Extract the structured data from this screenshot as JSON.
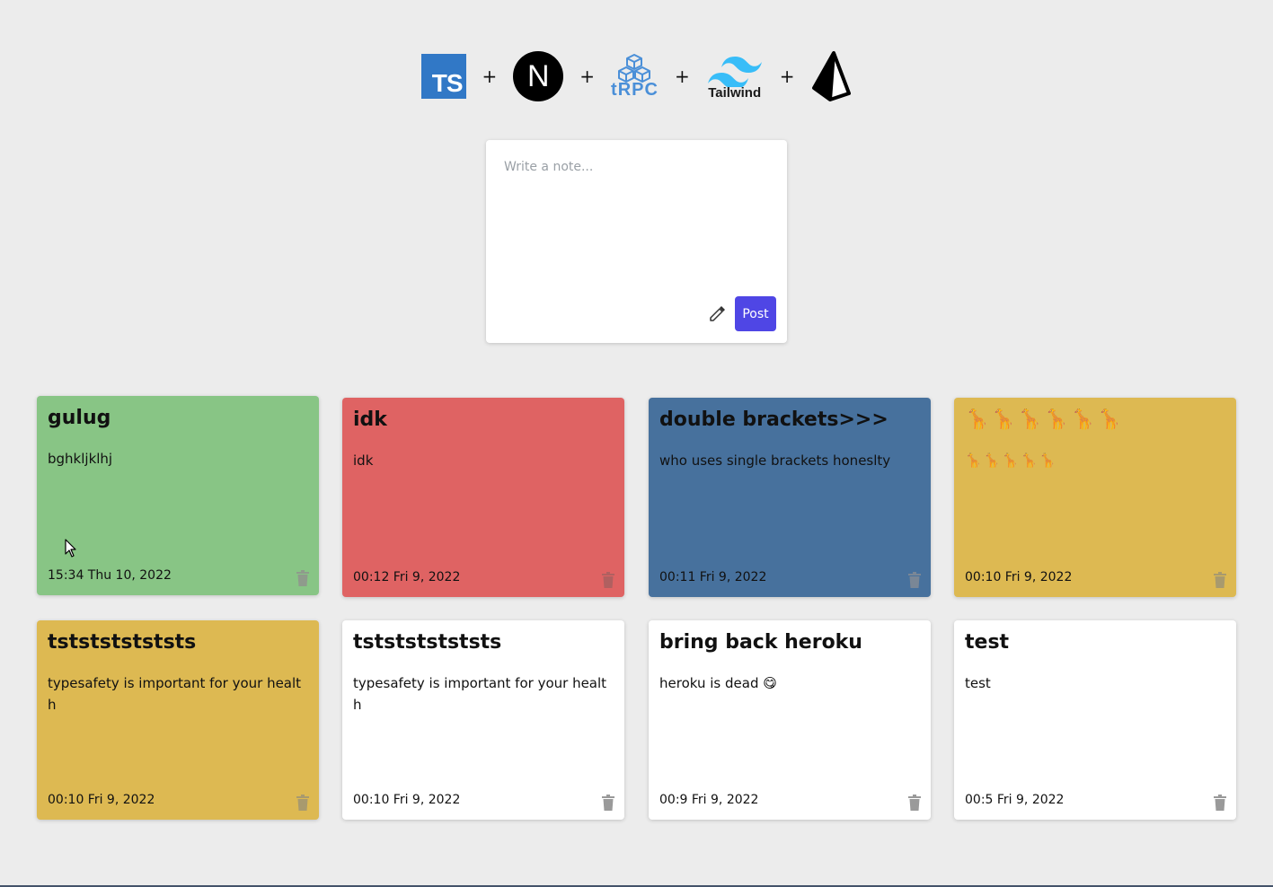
{
  "logos": [
    {
      "name": "typescript",
      "text": "TS"
    },
    {
      "name": "nextjs",
      "text": "N"
    },
    {
      "name": "trpc",
      "text": "tRPC"
    },
    {
      "name": "tailwind",
      "text": "Tailwind"
    },
    {
      "name": "prisma",
      "text": ""
    }
  ],
  "plus": "+",
  "composer": {
    "placeholder": "Write a note...",
    "value": "",
    "post_label": "Post",
    "picker_icon": "eyedropper-icon"
  },
  "colors": {
    "green": "#88c585",
    "red": "#df6363",
    "blue": "#47719d",
    "yellow": "#ddb952",
    "white": "#ffffff",
    "accent": "#4f46e5",
    "trash": "#9a9a9a"
  },
  "notes": [
    {
      "title": "gulug",
      "body": "bghkljklhj",
      "time": "15:34 Thu 10, 2022",
      "color": "#88c585"
    },
    {
      "title": "idk",
      "body": "idk",
      "time": "00:12 Fri 9, 2022",
      "color": "#df6363"
    },
    {
      "title": "double brackets>>>",
      "body": "who uses single brackets honeslty",
      "time": "00:11 Fri 9, 2022",
      "color": "#47719d"
    },
    {
      "title": "🦒🦒🦒🦒🦒🦒",
      "body": "🦒🦒🦒🦒🦒",
      "time": "00:10 Fri 9, 2022",
      "color": "#ddb952"
    },
    {
      "title": "tststststststs",
      "body": "typesafety is important for your health",
      "time": "00:10 Fri 9, 2022",
      "color": "#ddb952"
    },
    {
      "title": "tststststststs",
      "body": "typesafety is important for your health",
      "time": "00:10 Fri 9, 2022",
      "color": "#ffffff"
    },
    {
      "title": "bring back heroku",
      "body": "heroku is dead 😋",
      "time": "00:9 Fri 9, 2022",
      "color": "#ffffff"
    },
    {
      "title": "test",
      "body": "test",
      "time": "00:5 Fri 9, 2022",
      "color": "#ffffff"
    }
  ]
}
